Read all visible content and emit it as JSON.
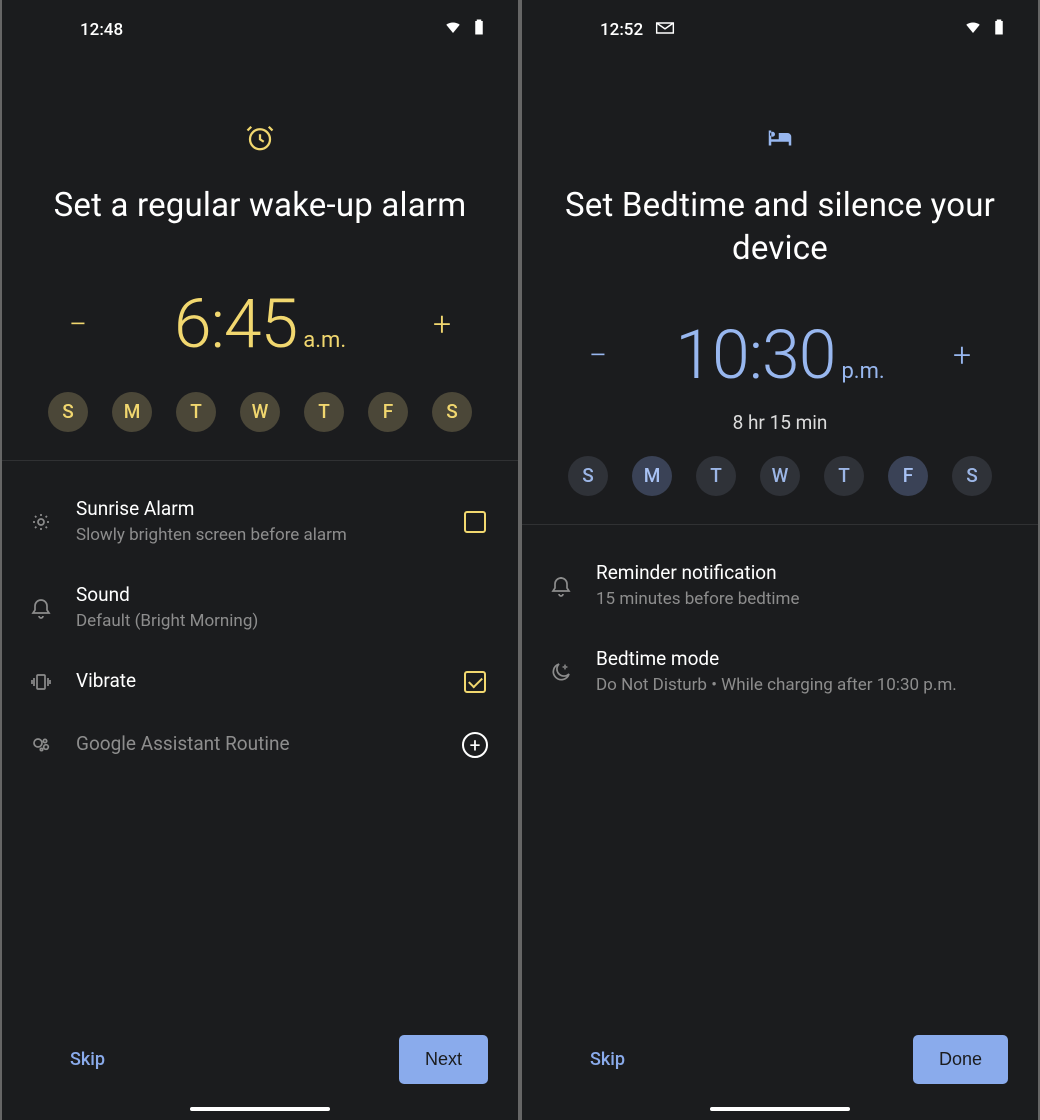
{
  "left": {
    "status": {
      "time": "12:48"
    },
    "title": "Set a regular wake-up alarm",
    "picker": {
      "time": "6:45",
      "ampm": "a.m."
    },
    "days": [
      "S",
      "M",
      "T",
      "W",
      "T",
      "F",
      "S"
    ],
    "settings": {
      "sunrise": {
        "title": "Sunrise Alarm",
        "sub": "Slowly brighten screen before alarm"
      },
      "sound": {
        "title": "Sound",
        "sub": "Default (Bright Morning)"
      },
      "vibrate": {
        "title": "Vibrate"
      },
      "routine": {
        "title": "Google Assistant Routine"
      }
    },
    "footer": {
      "skip": "Skip",
      "primary": "Next"
    }
  },
  "right": {
    "status": {
      "time": "12:52"
    },
    "title": "Set Bedtime and silence your device",
    "picker": {
      "time": "10:30",
      "ampm": "p.m.",
      "duration": "8 hr 15 min"
    },
    "days": [
      "S",
      "M",
      "T",
      "W",
      "T",
      "F",
      "S"
    ],
    "settings": {
      "reminder": {
        "title": "Reminder notification",
        "sub": "15 minutes before bedtime"
      },
      "bedtime": {
        "title": "Bedtime mode",
        "sub": "Do Not Disturb • While charging after 10:30 p.m."
      }
    },
    "footer": {
      "skip": "Skip",
      "primary": "Done"
    }
  }
}
